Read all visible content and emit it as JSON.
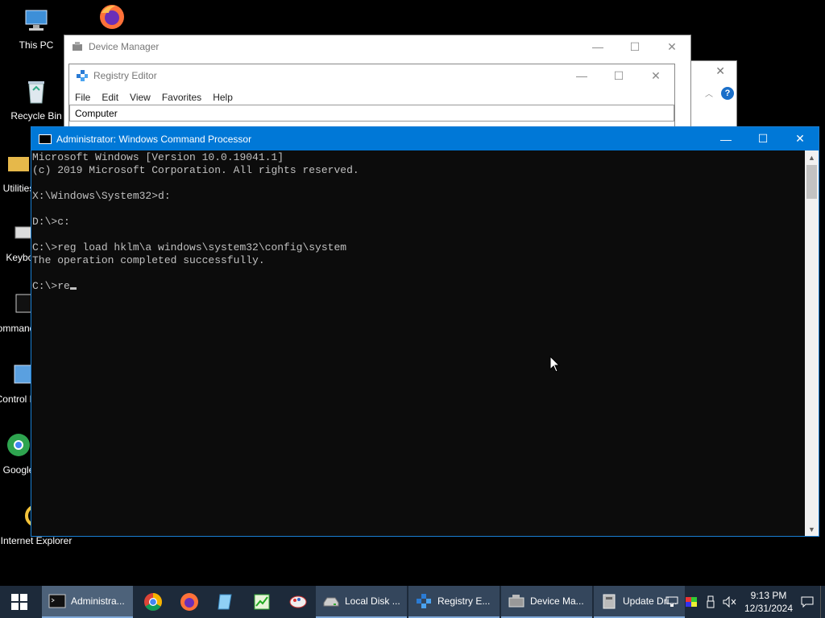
{
  "desktop": {
    "icons": [
      {
        "label": "This PC"
      },
      {
        "label": "Recycle Bin"
      },
      {
        "label": "Utilities"
      },
      {
        "label": "Chrome"
      },
      {
        "label": "Keyboard"
      },
      {
        "label": "Command Prompt"
      },
      {
        "label": "Control Panel"
      },
      {
        "label": "Google"
      },
      {
        "label": "Internet Explorer"
      }
    ]
  },
  "device_manager": {
    "title": "Device Manager"
  },
  "update_drivers": {
    "help": "?"
  },
  "registry_editor": {
    "title": "Registry Editor",
    "menu": [
      "File",
      "Edit",
      "View",
      "Favorites",
      "Help"
    ],
    "address": "Computer"
  },
  "cmd": {
    "title": "Administrator: Windows Command Processor",
    "lines": [
      "Microsoft Windows [Version 10.0.19041.1]",
      "(c) 2019 Microsoft Corporation. All rights reserved.",
      "",
      "X:\\Windows\\System32>d:",
      "",
      "D:\\>c:",
      "",
      "C:\\>reg load hklm\\a windows\\system32\\config\\system",
      "The operation completed successfully.",
      "",
      "C:\\>re"
    ]
  },
  "window_controls": {
    "minimize": "—",
    "maximize": "☐",
    "close": "✕"
  },
  "taskbar": {
    "buttons": [
      {
        "label": "Administra..."
      },
      {
        "label": "Local Disk ..."
      },
      {
        "label": "Registry E..."
      },
      {
        "label": "Device Ma..."
      },
      {
        "label": "Update Dri..."
      }
    ],
    "time": "9:13 PM",
    "date": "12/31/2024"
  }
}
